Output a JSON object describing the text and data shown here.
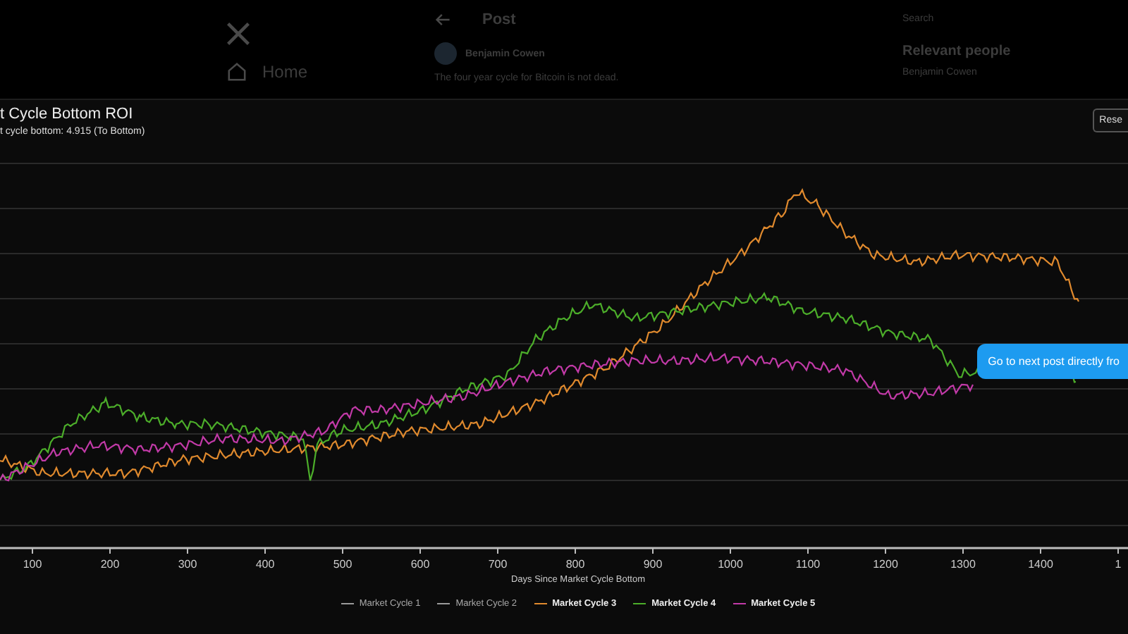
{
  "background_page": {
    "nav_items": [
      {
        "label": "Home"
      }
    ],
    "post_header": {
      "title": "Post"
    },
    "post": {
      "author": "Benjamin Cowen",
      "text": "The four year cycle for Bitcoin is not dead."
    },
    "sidebar": {
      "search_placeholder": "Search",
      "heading": "Relevant people",
      "person": "Benjamin Cowen"
    }
  },
  "chart_panel": {
    "title": "t Cycle Bottom ROI",
    "subtitle": "t cycle bottom: 4.915 (To Bottom)",
    "reset_button": "Rese",
    "x_tick_labels": [
      "100",
      "200",
      "300",
      "400",
      "500",
      "600",
      "700",
      "800",
      "900",
      "1000",
      "1100",
      "1200",
      "1300",
      "1400",
      "1"
    ],
    "x_axis_label": "Days Since Market Cycle Bottom",
    "legend": [
      {
        "label": "Market Cycle 1",
        "color": "#9a9a9a",
        "hidden": true
      },
      {
        "label": "Market Cycle 2",
        "color": "#9a9a9a",
        "hidden": true
      },
      {
        "label": "Market Cycle 3",
        "color": "#e08a2e",
        "hidden": false
      },
      {
        "label": "Market Cycle 4",
        "color": "#4cae2a",
        "hidden": false
      },
      {
        "label": "Market Cycle 5",
        "color": "#c23aa8",
        "hidden": false
      }
    ]
  },
  "toast": {
    "text": "Go to next post directly fro"
  }
}
